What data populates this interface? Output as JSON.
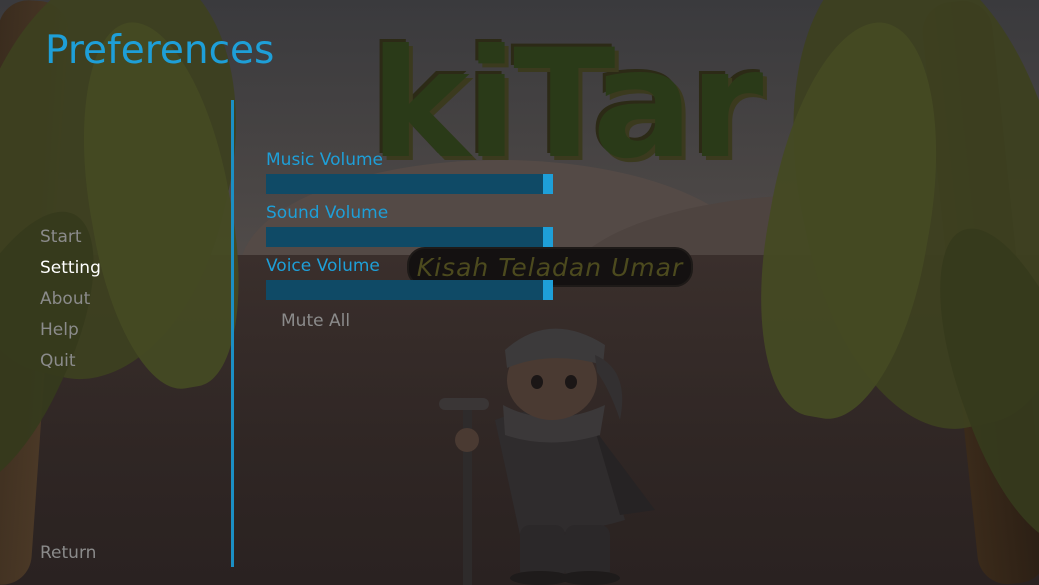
{
  "screen": {
    "title": "Preferences"
  },
  "logo": {
    "main_text": "kiTar",
    "subtitle": "Kisah Teladan Umar"
  },
  "nav": {
    "items": [
      {
        "label": "Start",
        "active": false
      },
      {
        "label": "Setting",
        "active": true
      },
      {
        "label": "About",
        "active": false
      },
      {
        "label": "Help",
        "active": false
      },
      {
        "label": "Quit",
        "active": false
      }
    ],
    "return_label": "Return"
  },
  "audio": {
    "music": {
      "label": "Music Volume",
      "level": 1.0
    },
    "sound": {
      "label": "Sound Volume",
      "level": 1.0
    },
    "voice": {
      "label": "Voice Volume",
      "level": 1.0
    },
    "mute_label": "Mute All"
  },
  "colors": {
    "accent": "#1e9fd8",
    "bar_track": "#0f4a66",
    "menu_idle": "#8b8b8b",
    "menu_active": "#ffffff"
  }
}
